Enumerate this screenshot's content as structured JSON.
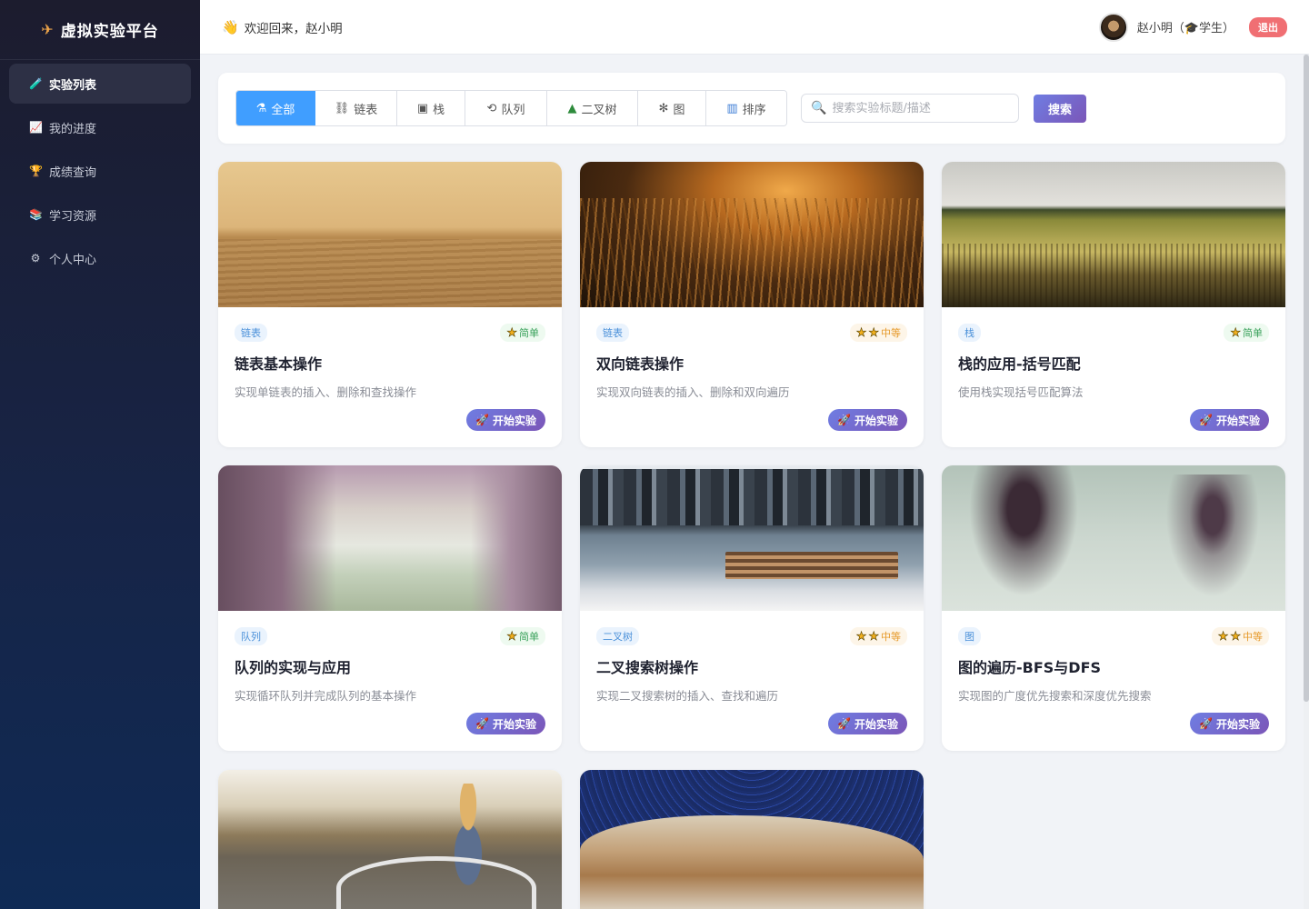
{
  "app": {
    "brand_icon": "rocket-icon",
    "brand_title": "虚拟实验平台"
  },
  "sidebar": {
    "items": [
      {
        "label": "实验列表",
        "icon": "test-tube-icon",
        "glyph": "🧪",
        "active": true
      },
      {
        "label": "我的进度",
        "icon": "chart-up-icon",
        "glyph": "📈",
        "active": false
      },
      {
        "label": "成绩查询",
        "icon": "trophy-icon",
        "glyph": "🏆",
        "active": false
      },
      {
        "label": "学习资源",
        "icon": "books-icon",
        "glyph": "📚",
        "active": false
      },
      {
        "label": "个人中心",
        "icon": "gear-icon",
        "glyph": "⚙",
        "active": false
      }
    ]
  },
  "header": {
    "welcome_icon": "waving-hand-icon",
    "welcome": "欢迎回来，赵小明",
    "user_name": "赵小明（🎓学生）",
    "logout": "退出"
  },
  "filters": {
    "tabs": [
      {
        "label": "全部",
        "icon": "flask-icon",
        "glyph": "⚗",
        "active": true
      },
      {
        "label": "链表",
        "icon": "chain-link-icon",
        "glyph": "⛓",
        "active": false
      },
      {
        "label": "栈",
        "icon": "box-icon",
        "glyph": "▣",
        "active": false
      },
      {
        "label": "队列",
        "icon": "cycle-icon",
        "glyph": "⟲",
        "active": false
      },
      {
        "label": "二叉树",
        "icon": "tree-icon",
        "glyph": "▲",
        "active": false
      },
      {
        "label": "图",
        "icon": "network-icon",
        "glyph": "✻",
        "active": false
      },
      {
        "label": "排序",
        "icon": "bar-chart-icon",
        "glyph": "▥",
        "active": false
      }
    ],
    "search_placeholder": "搜索实验标题/描述",
    "search_value": "",
    "search_button": "搜索"
  },
  "experiments": [
    {
      "category": "链表",
      "difficulty": "简单",
      "stars": 1,
      "title": "链表基本操作",
      "desc": "实现单链表的插入、删除和查找操作",
      "button": "开始实验",
      "image": "desert-dunes"
    },
    {
      "category": "链表",
      "difficulty": "中等",
      "stars": 2,
      "title": "双向链表操作",
      "desc": "实现双向链表的插入、删除和双向遍历",
      "button": "开始实验",
      "image": "golden-grass"
    },
    {
      "category": "栈",
      "difficulty": "简单",
      "stars": 1,
      "title": "栈的应用-括号匹配",
      "desc": "使用栈实现括号匹配算法",
      "button": "开始实验",
      "image": "wheat-field"
    },
    {
      "category": "队列",
      "difficulty": "简单",
      "stars": 1,
      "title": "队列的实现与应用",
      "desc": "实现循环队列并完成队列的基本操作",
      "button": "开始实验",
      "image": "tree-lined-road"
    },
    {
      "category": "二叉树",
      "difficulty": "中等",
      "stars": 2,
      "title": "二叉搜索树操作",
      "desc": "实现二叉搜索树的插入、查找和遍历",
      "button": "开始实验",
      "image": "city-bench"
    },
    {
      "category": "图",
      "difficulty": "中等",
      "stars": 2,
      "title": "图的遍历-BFS与DFS",
      "desc": "实现图的广度优先搜索和深度优先搜索",
      "button": "开始实验",
      "image": "foggy-trees"
    },
    {
      "image": "girl-bicycle"
    },
    {
      "image": "star-trails-rocks"
    }
  ]
}
